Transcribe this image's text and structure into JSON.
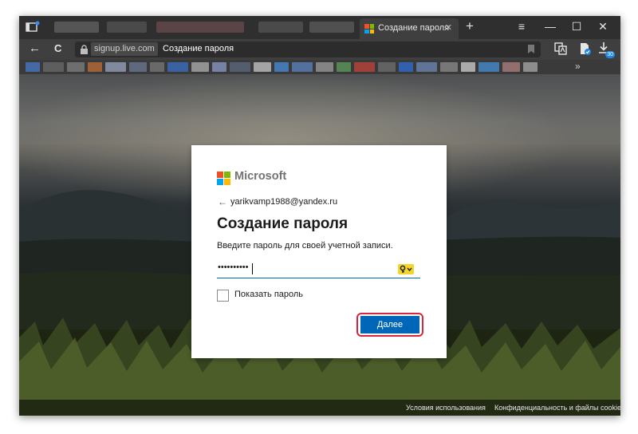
{
  "tabs": {
    "active_title": "Создание пароля",
    "close_glyph": "✕",
    "new_tab_glyph": "+",
    "blurred_tabs": [
      "#555555",
      "#4a4a4a",
      "#5a4446",
      "#4a4a4a",
      "#505050"
    ]
  },
  "window_controls": {
    "menu": "≡",
    "minimize": "—",
    "maximize": "☐",
    "close": "✕"
  },
  "address_bar": {
    "back": "←",
    "reload": "C",
    "domain": "signup.live.com",
    "page_title": "Создание пароля"
  },
  "toolbar": {
    "downloads_badge": "30"
  },
  "bookmarks": {
    "more_glyph": "»",
    "colors": [
      "#4a79c8",
      "#6b6b6b",
      "#808080",
      "#c06d3a",
      "#9aa4c0",
      "#6c7a96",
      "#7a7a7a",
      "#3b6fc4",
      "#b0b0b0",
      "#8a9bc8",
      "#5d6a80",
      "#c8c8c8",
      "#4a8dd8",
      "#5c84c0",
      "#9e9e9e",
      "#5e9e5a",
      "#c2443a",
      "#707070",
      "#2f6fd6",
      "#6e88b8",
      "#8c8c8c",
      "#d0d0d0",
      "#4690d8",
      "#b08080",
      "#a9a9a9"
    ]
  },
  "card": {
    "brand": "Microsoft",
    "back_glyph": "←",
    "identity": "yarikvamp1988@yandex.ru",
    "heading": "Создание пароля",
    "instructions": "Введите пароль для своей учетной записи.",
    "password_mask": "••••••••••",
    "show_password_label": "Показать пароль",
    "next_label": "Далее"
  },
  "footer": {
    "terms": "Условия использования",
    "privacy": "Конфиденциальность и файлы cookie"
  },
  "colors": {
    "ms_red": "#f25022",
    "ms_green": "#7fba00",
    "ms_blue": "#00a4ef",
    "ms_yellow": "#ffb900",
    "accent_blue": "#0067b8",
    "highlight_red": "#d7263d",
    "key_yellow": "#f2d629"
  }
}
